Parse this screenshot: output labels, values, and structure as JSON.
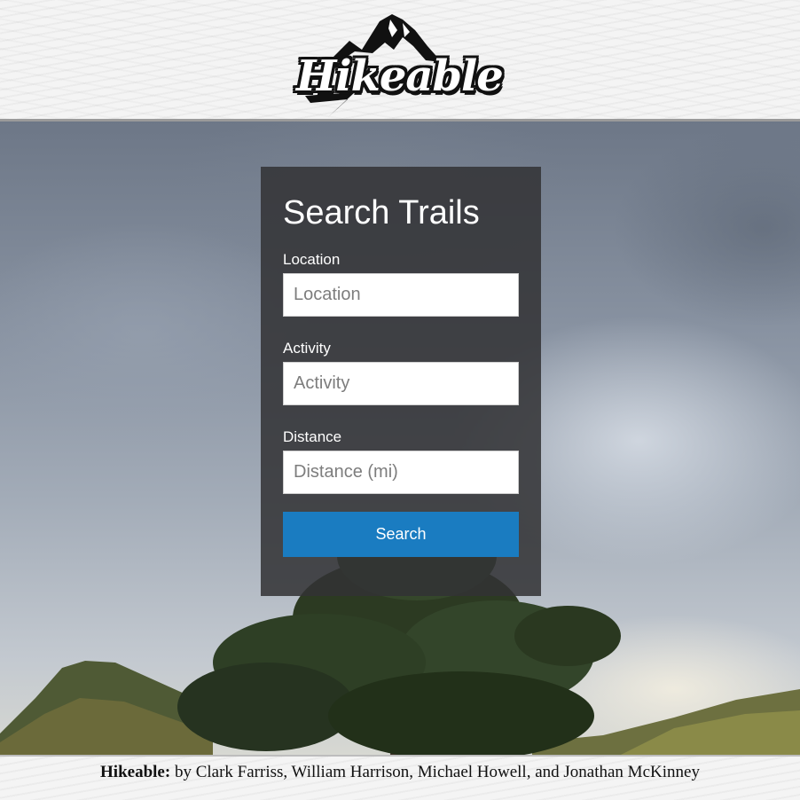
{
  "header": {
    "logo_text": "Hikeable"
  },
  "search": {
    "title": "Search Trails",
    "fields": [
      {
        "label": "Location",
        "placeholder": "Location"
      },
      {
        "label": "Activity",
        "placeholder": "Activity"
      },
      {
        "label": "Distance",
        "placeholder": "Distance (mi)"
      }
    ],
    "button_label": "Search"
  },
  "footer": {
    "brand": "Hikeable:",
    "credits": " by Clark Farriss, William Harrison, Michael Howell, and Jonathan McKinney"
  },
  "colors": {
    "button": "#1a7cc1",
    "panel": "#323234"
  }
}
